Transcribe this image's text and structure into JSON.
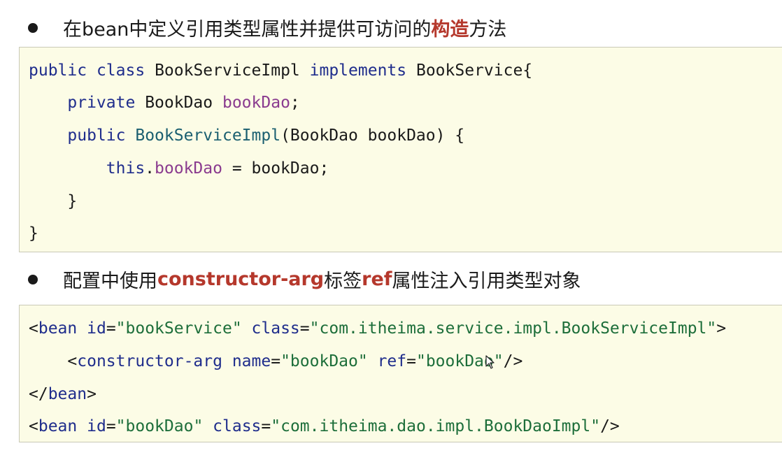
{
  "section1": {
    "text_before": "在bean中定义引用类型属性并提供可访问的",
    "emphasis": "构造",
    "text_after": "方法"
  },
  "java_code": {
    "l1_public": "public",
    "l1_class": "class",
    "l1_name": "BookServiceImpl",
    "l1_implements": "implements",
    "l1_iface": "BookService{",
    "l2_private": "private",
    "l2_type": "BookDao",
    "l2_field": "bookDao",
    "l2_semi": ";",
    "l3_public": "public",
    "l3_ctor": "BookServiceImpl",
    "l3_params": "(BookDao bookDao) {",
    "l4_this": "this",
    "l4_dot": ".",
    "l4_field": "bookDao",
    "l4_rest": " = bookDao;",
    "l5_close": "}",
    "l6_close": "}"
  },
  "section2": {
    "text_before": "配置中使用",
    "emphasis1": "constructor-arg",
    "text_middle": "标签",
    "emphasis2": "ref",
    "text_after": "属性注入引用类型对象"
  },
  "xml_code": {
    "l1_lt": "<",
    "l1_tag": "bean",
    "l1_id_attr": "id",
    "l1_eq1": "=",
    "l1_id_val": "\"bookService\"",
    "l1_class_attr": "class",
    "l1_eq2": "=",
    "l1_class_val": "\"com.itheima.service.impl.BookServiceImpl\"",
    "l1_gt": ">",
    "l2_lt": "<",
    "l2_tag": "constructor-arg",
    "l2_name_attr": "name",
    "l2_eq1": "=",
    "l2_name_val": "\"bookDao\"",
    "l2_ref_attr": "ref",
    "l2_eq2": "=",
    "l2_ref_val": "\"bookDao\"",
    "l2_end": "/>",
    "l3_lt": "</",
    "l3_tag": "bean",
    "l3_gt": ">",
    "l4_lt": "<",
    "l4_tag": "bean",
    "l4_id_attr": "id",
    "l4_eq1": "=",
    "l4_id_val": "\"bookDao\"",
    "l4_class_attr": "class",
    "l4_eq2": "=",
    "l4_class_val": "\"com.itheima.dao.impl.BookDaoImpl\"",
    "l4_end": "/>"
  },
  "icons": {
    "cursor": "mouse-cursor-icon"
  }
}
